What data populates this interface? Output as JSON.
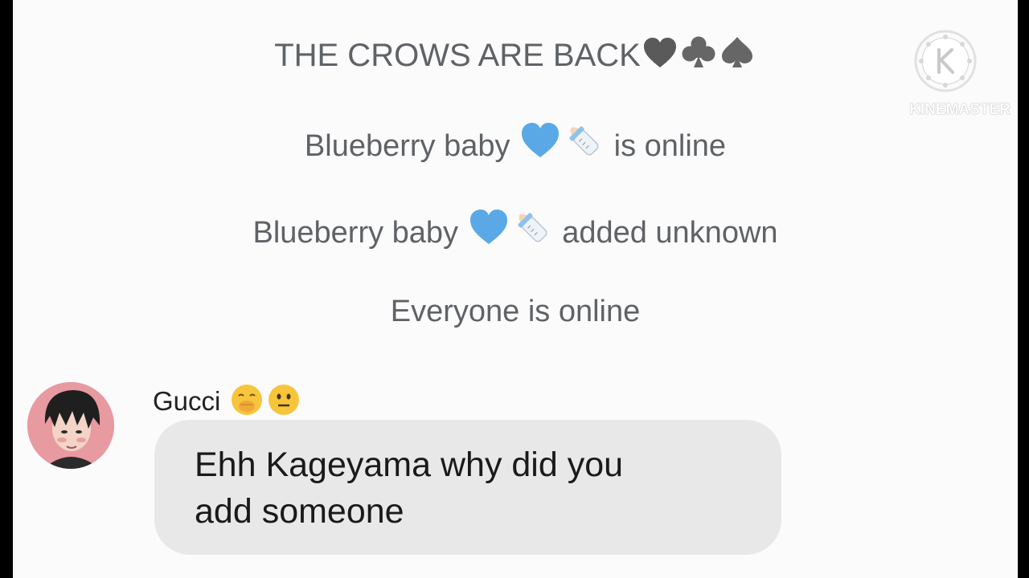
{
  "notices": {
    "group_title": "THE CROWS ARE BACK",
    "line2_name": "Blueberry baby",
    "line2_action": "is online",
    "line3_name": "Blueberry baby",
    "line3_action": "added unknown",
    "line4": "Everyone is online"
  },
  "message": {
    "sender": "Gucci",
    "text_line1": "Ehh Kageyama why did you",
    "text_line2": "add someone"
  },
  "watermark": {
    "label": "KINEMASTER"
  },
  "icons": [
    "black-heart-icon",
    "club-suit-icon",
    "spade-suit-icon",
    "blue-heart-icon",
    "baby-bottle-icon",
    "hand-over-mouth-face-icon",
    "neutral-face-icon",
    "kinemaster-logo-icon"
  ]
}
